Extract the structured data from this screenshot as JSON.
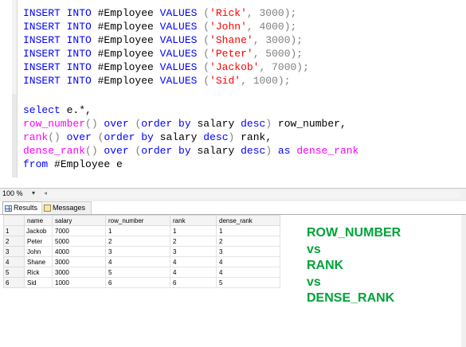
{
  "editor": {
    "lines": [
      {
        "kw1": "INSERT INTO",
        "tbl": " #Employee ",
        "kw2": "VALUES",
        "p1": " (",
        "name": "'Rick'",
        "p2": ", 3000);"
      },
      {
        "kw1": "INSERT INTO",
        "tbl": " #Employee ",
        "kw2": "VALUES",
        "p1": " (",
        "name": "'John'",
        "p2": ", 4000);"
      },
      {
        "kw1": "INSERT INTO",
        "tbl": " #Employee ",
        "kw2": "VALUES",
        "p1": " (",
        "name": "'Shane'",
        "p2": ", 3000);"
      },
      {
        "kw1": "INSERT INTO",
        "tbl": " #Employee ",
        "kw2": "VALUES",
        "p1": " (",
        "name": "'Peter'",
        "p2": ", 5000);"
      },
      {
        "kw1": "INSERT INTO",
        "tbl": " #Employee ",
        "kw2": "VALUES",
        "p1": " (",
        "name": "'Jackob'",
        "p2": ", 7000);"
      },
      {
        "kw1": "INSERT INTO",
        "tbl": " #Employee ",
        "kw2": "VALUES",
        "p1": " (",
        "name": "'Sid'",
        "p2": ", 1000);"
      }
    ],
    "select_line": {
      "kw": "select",
      "rest": " e.*,"
    },
    "row_number_line": {
      "fn": "row_number",
      "p1": "()",
      "kw_over": " over ",
      "p2": "(",
      "kw_order": "order by",
      "col": " salary ",
      "kw_desc": "desc",
      "p3": ")",
      "alias": " row_number,"
    },
    "rank_line": {
      "fn": "rank",
      "p1": "()",
      "kw_over": " over ",
      "p2": "(",
      "kw_order": "order by",
      "col": " salary ",
      "kw_desc": "desc",
      "p3": ")",
      "alias": " rank,"
    },
    "dense_rank_line": {
      "fn": "dense_rank",
      "p1": "()",
      "kw_over": " over ",
      "p2": "(",
      "kw_order": "order by",
      "col": " salary ",
      "kw_desc": "desc",
      "p3": ")",
      "kw_as": " as ",
      "alias": "dense_rank"
    },
    "from_line": {
      "kw": "from",
      "rest": " #Employee e"
    }
  },
  "zoom": {
    "label": "100 %",
    "arrow": "▾"
  },
  "tabs": {
    "results": "Results",
    "messages": "Messages"
  },
  "grid": {
    "headers": [
      "name",
      "salary",
      "row_number",
      "rank",
      "dense_rank"
    ],
    "rows": [
      {
        "n": "1",
        "name": "Jackob",
        "salary": "7000",
        "row_number": "1",
        "rank": "1",
        "dense_rank": "1"
      },
      {
        "n": "2",
        "name": "Peter",
        "salary": "5000",
        "row_number": "2",
        "rank": "2",
        "dense_rank": "2"
      },
      {
        "n": "3",
        "name": "John",
        "salary": "4000",
        "row_number": "3",
        "rank": "3",
        "dense_rank": "3"
      },
      {
        "n": "4",
        "name": "Shane",
        "salary": "3000",
        "row_number": "4",
        "rank": "4",
        "dense_rank": "4"
      },
      {
        "n": "5",
        "name": "Rick",
        "salary": "3000",
        "row_number": "5",
        "rank": "4",
        "dense_rank": "4"
      },
      {
        "n": "6",
        "name": "Sid",
        "salary": "1000",
        "row_number": "6",
        "rank": "6",
        "dense_rank": "5"
      }
    ]
  },
  "annotation": {
    "l1": "ROW_NUMBER",
    "l2": "vs",
    "l3": "RANK",
    "l4": "vs",
    "l5": "DENSE_RANK"
  },
  "colors": {
    "keyword": "#0000ff",
    "function": "#ff00ff",
    "string": "#ff0000",
    "annotation": "#00a33a"
  }
}
